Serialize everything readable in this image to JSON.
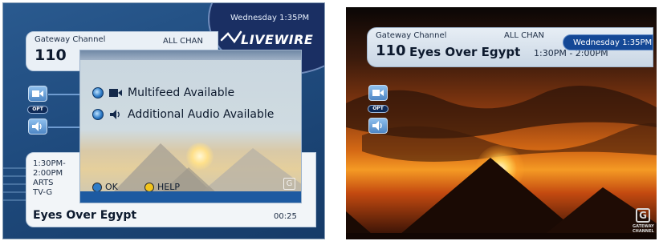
{
  "left_screen": {
    "channel_label": "Gateway Channel",
    "channel_number": "110",
    "filter_label": "ALL CHAN",
    "datetime": "Wednesday 1:35PM",
    "brand_logo": "LIVEWIRE",
    "side_icons": [
      "video-icon",
      "opt-badge",
      "audio-icon"
    ],
    "opt_label": "OPT",
    "popup": {
      "rows": [
        {
          "label": "Multifeed Available",
          "icon": "video-icon"
        },
        {
          "label": "Additional Audio Available",
          "icon": "speaker-icon"
        }
      ],
      "ok_label": "OK",
      "help_label": "HELP",
      "ok_color": "#2f7cc7",
      "help_color": "#f2c41d"
    },
    "info": {
      "meta": "1:30PM-\n2:00PM\nARTS\nTV-G",
      "title": "Eyes Over Egypt",
      "elapsed": "00:25"
    }
  },
  "right_screen": {
    "channel_label": "Gateway Channel",
    "filter_label": "ALL CHAN",
    "datetime": "Wednesday 1:35PM",
    "channel_number": "110",
    "program_title": "Eyes Over Egypt",
    "time_slot": "1:30PM - 2:00PM",
    "opt_label": "OPT",
    "corner_logo_letter": "G",
    "corner_logo_text": "GATEWAY CHANNEL"
  },
  "colors": {
    "panel_blue": "#1f4b7e",
    "accent_blue": "#144896",
    "sunset_orange": "#f59a24"
  }
}
